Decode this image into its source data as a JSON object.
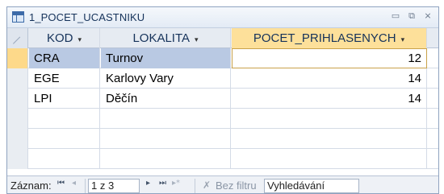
{
  "window": {
    "title": "1_POCET_UCASTNIKU",
    "icon": "table-icon",
    "controls": {
      "minimize": "▭",
      "restore": "⧉",
      "close": "⨯"
    }
  },
  "columns": [
    {
      "label": "KOD",
      "arrow": "▾"
    },
    {
      "label": "LOKALITA",
      "arrow": "▾"
    },
    {
      "label": "POCET_PRIHLASENYCH",
      "arrow": "▾"
    }
  ],
  "rows": [
    {
      "kod": "CRA",
      "lokalita": "Turnov",
      "pocet": "12"
    },
    {
      "kod": "EGE",
      "lokalita": "Karlovy Vary",
      "pocet": "14"
    },
    {
      "kod": "LPI",
      "lokalita": "Děčín",
      "pocet": "14"
    }
  ],
  "navigation": {
    "label": "Záznam:",
    "first": "⏮",
    "prev": "◂",
    "position": "1 z 3",
    "next": "▸",
    "last": "⏭",
    "new": "▸*",
    "filter_icon": "funnel-icon",
    "filter_label": "Bez filtru",
    "search_placeholder": "Vyhledávání"
  },
  "colors": {
    "header_active": "#fde09a",
    "row_selected": "#b9c9e3",
    "selector_current": "#fdd98a"
  }
}
